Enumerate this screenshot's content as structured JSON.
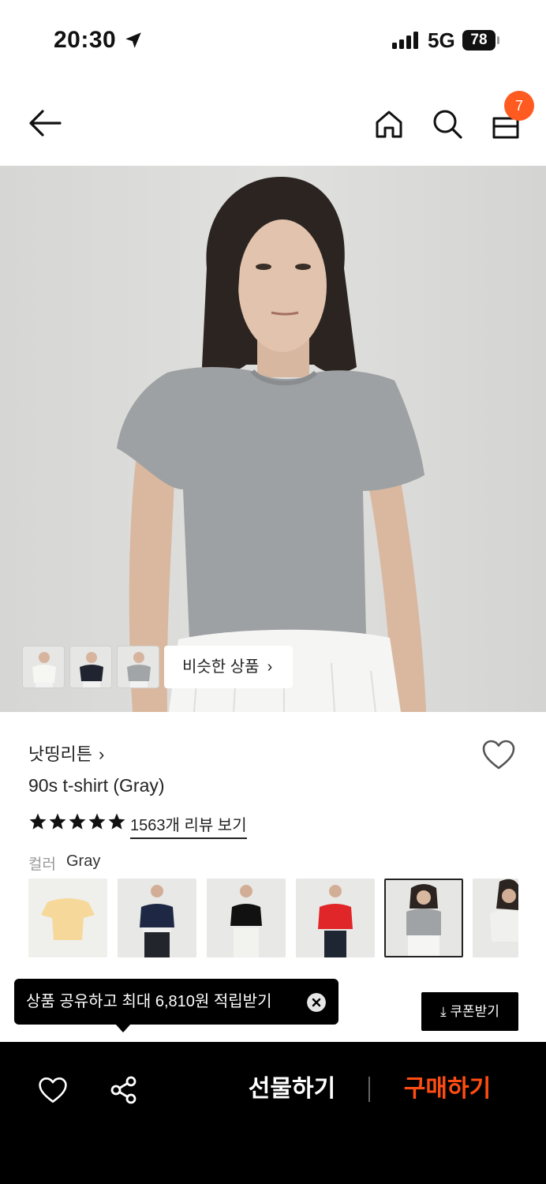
{
  "status_bar": {
    "time": "20:30",
    "network": "5G",
    "battery": "78"
  },
  "nav": {
    "cart_count": "7",
    "icons": [
      "back-arrow-icon",
      "home-icon",
      "search-icon",
      "shopping-bag-icon"
    ]
  },
  "gallery": {
    "similar_label": "비슷한 상품",
    "similar_chevron": "›"
  },
  "product": {
    "brand": "낫띵리튼",
    "brand_chevron": "›",
    "name": "90s t-shirt (Gray)",
    "rating_stars": 5,
    "review_link": "1563개 리뷰 보기",
    "color_label": "컬러",
    "color_value": "Gray"
  },
  "colors": {
    "swatches": [
      "beige",
      "navy",
      "black",
      "red",
      "gray",
      "light-gray"
    ],
    "selected": "gray"
  },
  "share_tooltip": {
    "text": "상품 공유하고 최대 6,810원 적립받기"
  },
  "coupon": {
    "label": "⤓ 쿠폰받기"
  },
  "bottom_bar": {
    "gift_label": "선물하기",
    "buy_label": "구매하기"
  },
  "theme": {
    "accent": "#ff4d12",
    "badge": "#ff5a1f"
  }
}
